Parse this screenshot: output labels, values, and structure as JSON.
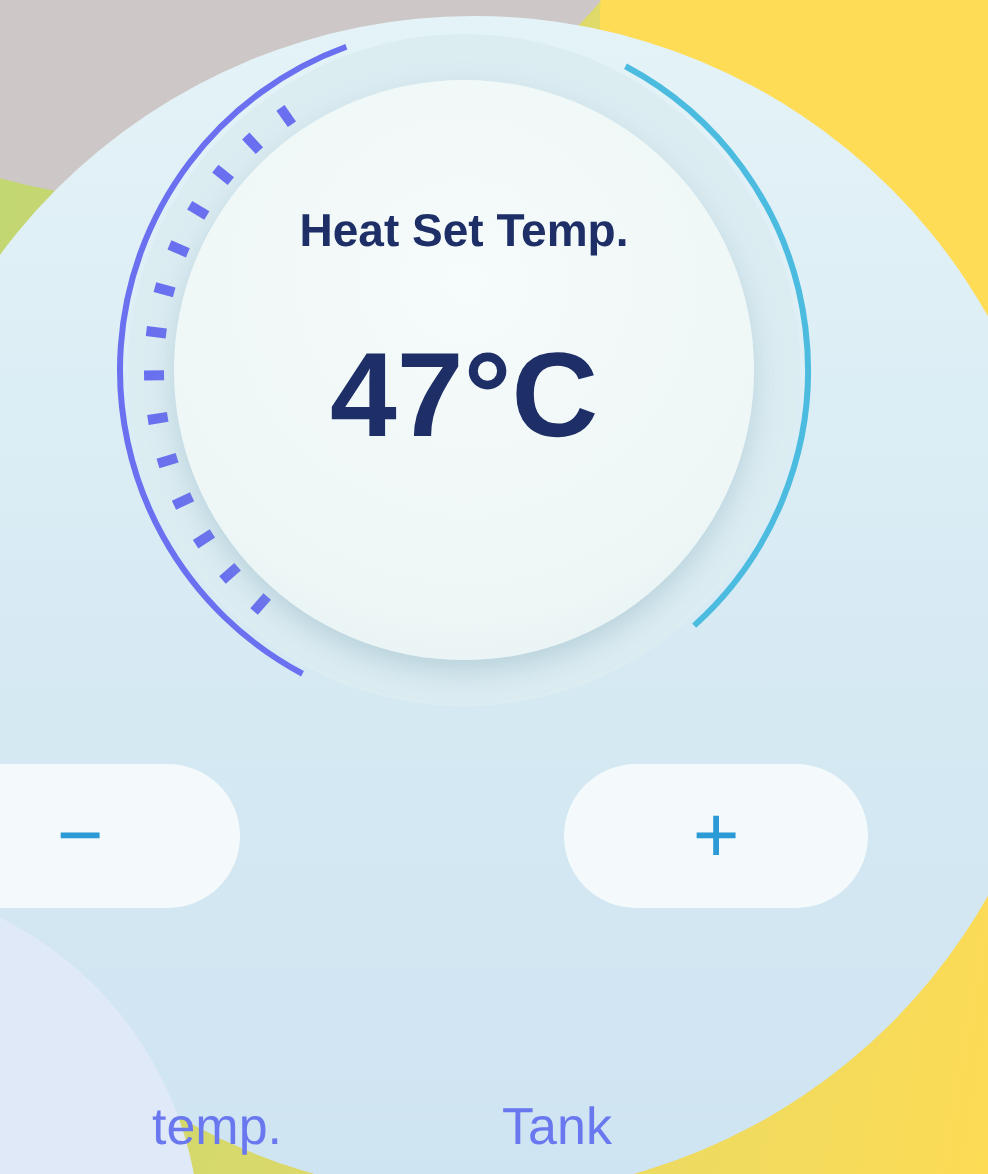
{
  "dial": {
    "title": "Heat Set Temp.",
    "value": "47°C"
  },
  "buttons": [
    {
      "kind": "minus",
      "label": "−"
    },
    {
      "kind": "plus",
      "label": "+"
    }
  ],
  "labels": [
    "temp.",
    "Tank"
  ]
}
